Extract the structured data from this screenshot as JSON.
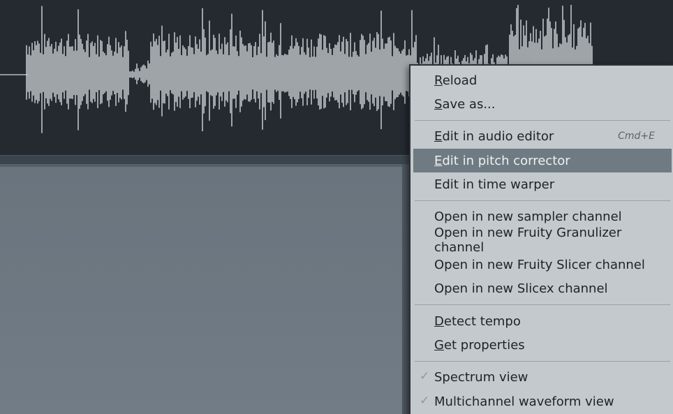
{
  "menu": {
    "items": [
      {
        "id": "reload",
        "label": "Reload",
        "shortcut": "",
        "checked": false,
        "highlighted": false
      },
      {
        "id": "save-as",
        "label": "Save as...",
        "shortcut": "",
        "checked": false,
        "highlighted": false
      },
      {
        "id": "edit-audio-editor",
        "label": "Edit in audio editor",
        "shortcut": "Cmd+E",
        "checked": false,
        "highlighted": false
      },
      {
        "id": "edit-pitch-corrector",
        "label": "Edit in pitch corrector",
        "shortcut": "",
        "checked": false,
        "highlighted": true
      },
      {
        "id": "edit-time-warper",
        "label": "Edit in time warper",
        "shortcut": "",
        "checked": false,
        "highlighted": false
      },
      {
        "id": "open-sampler",
        "label": "Open in new sampler channel",
        "shortcut": "",
        "checked": false,
        "highlighted": false
      },
      {
        "id": "open-granulizer",
        "label": "Open in new Fruity Granulizer channel",
        "shortcut": "",
        "checked": false,
        "highlighted": false
      },
      {
        "id": "open-slicer",
        "label": "Open in new Fruity Slicer channel",
        "shortcut": "",
        "checked": false,
        "highlighted": false
      },
      {
        "id": "open-slicex",
        "label": "Open in new Slicex channel",
        "shortcut": "",
        "checked": false,
        "highlighted": false
      },
      {
        "id": "detect-tempo",
        "label": "Detect tempo",
        "shortcut": "",
        "checked": false,
        "highlighted": false
      },
      {
        "id": "get-properties",
        "label": "Get properties",
        "shortcut": "",
        "checked": false,
        "highlighted": false
      },
      {
        "id": "spectrum-view",
        "label": "Spectrum view",
        "shortcut": "",
        "checked": true,
        "highlighted": false
      },
      {
        "id": "multichannel-waveform",
        "label": "Multichannel waveform view",
        "shortcut": "",
        "checked": true,
        "highlighted": false
      }
    ],
    "check_glyph": "✓"
  },
  "colors": {
    "waveform_bg": "#242a30",
    "waveform": "#d2d8db",
    "menu_bg": "#c3c9cc",
    "highlight": "#6f7a82"
  }
}
